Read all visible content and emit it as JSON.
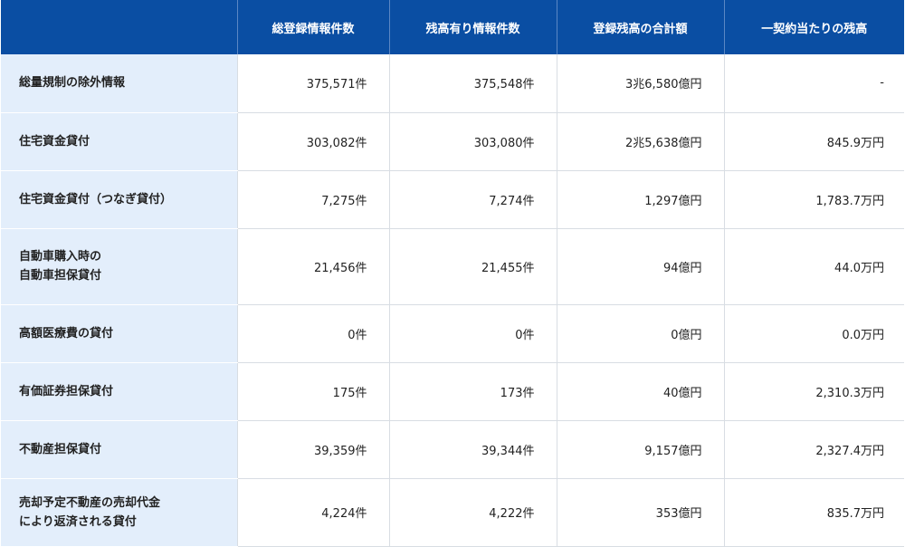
{
  "table": {
    "headers": [
      "",
      "総登録情報件数",
      "残高有り情報件数",
      "登録残高の合計額",
      "一契約当たりの残高"
    ],
    "rows": [
      {
        "label": [
          "総量規制の除外情報"
        ],
        "values": [
          "375,571件",
          "375,548件",
          "3兆6,580億円",
          "-"
        ]
      },
      {
        "label": [
          "住宅資金貸付"
        ],
        "values": [
          "303,082件",
          "303,080件",
          "2兆5,638億円",
          "845.9万円"
        ]
      },
      {
        "label": [
          "住宅資金貸付（つなぎ貸付）"
        ],
        "values": [
          "7,275件",
          "7,274件",
          "1,297億円",
          "1,783.7万円"
        ]
      },
      {
        "label": [
          "自動車購入時の",
          "自動車担保貸付"
        ],
        "values": [
          "21,456件",
          "21,455件",
          "94億円",
          "44.0万円"
        ]
      },
      {
        "label": [
          "高額医療費の貸付"
        ],
        "values": [
          "0件",
          "0件",
          "0億円",
          "0.0万円"
        ]
      },
      {
        "label": [
          "有価証券担保貸付"
        ],
        "values": [
          "175件",
          "173件",
          "40億円",
          "2,310.3万円"
        ]
      },
      {
        "label": [
          "不動産担保貸付"
        ],
        "values": [
          "39,359件",
          "39,344件",
          "9,157億円",
          "2,327.4万円"
        ]
      },
      {
        "label": [
          "売却予定不動産の売却代金",
          "により返済される貸付"
        ],
        "values": [
          "4,224件",
          "4,222件",
          "353億円",
          "835.7万円"
        ]
      }
    ]
  },
  "colors": {
    "header_bg": "#0a4ea3",
    "row_head_bg": "#e3eefb",
    "border": "#d8dde3"
  }
}
